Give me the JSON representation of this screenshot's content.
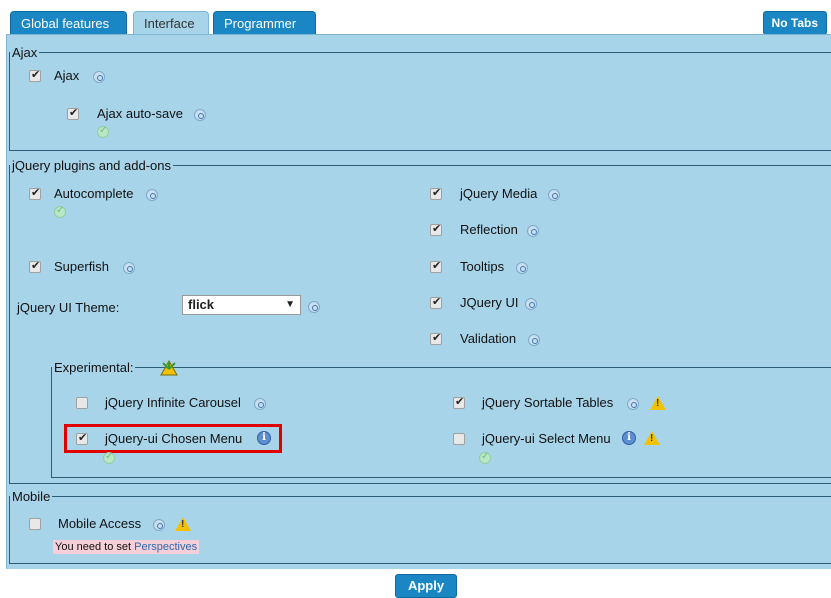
{
  "tabs": [
    {
      "label": "Global features",
      "active": false
    },
    {
      "label": "Interface",
      "active": true
    },
    {
      "label": "Programmer",
      "active": false
    }
  ],
  "no_tabs_label": "No Tabs",
  "sections": {
    "ajax": {
      "title": "Ajax",
      "items": [
        {
          "label": "Ajax",
          "checked": true
        },
        {
          "label": "Ajax auto-save",
          "checked": true
        }
      ]
    },
    "jquery": {
      "title": "jQuery plugins and add-ons",
      "left": [
        {
          "label": "Autocomplete",
          "checked": true
        },
        {
          "label": "Superfish",
          "checked": true
        }
      ],
      "theme_label": "jQuery UI Theme:",
      "theme_value": "flick",
      "right": [
        {
          "label": "jQuery Media",
          "checked": true
        },
        {
          "label": "Reflection",
          "checked": true
        },
        {
          "label": "Tooltips",
          "checked": true
        },
        {
          "label": "JQuery UI",
          "checked": true
        },
        {
          "label": "Validation",
          "checked": true
        }
      ],
      "experimental": {
        "title": "Experimental:",
        "items": [
          {
            "label": "jQuery Infinite Carousel",
            "checked": false
          },
          {
            "label": "jQuery-ui Chosen Menu",
            "checked": true,
            "highlighted": true
          },
          {
            "label": "jQuery Sortable Tables",
            "checked": true
          },
          {
            "label": "jQuery-ui Select Menu",
            "checked": false
          }
        ]
      }
    },
    "mobile": {
      "title": "Mobile",
      "items": [
        {
          "label": "Mobile Access",
          "checked": false
        }
      ],
      "notice_text": "You need to set",
      "notice_link": "Perspectives"
    }
  },
  "apply_label": "Apply",
  "colors": {
    "panel": "#a8d4ea",
    "tab": "#1b86c4",
    "highlight": "#e00000",
    "notice": "#f6cfd8"
  }
}
